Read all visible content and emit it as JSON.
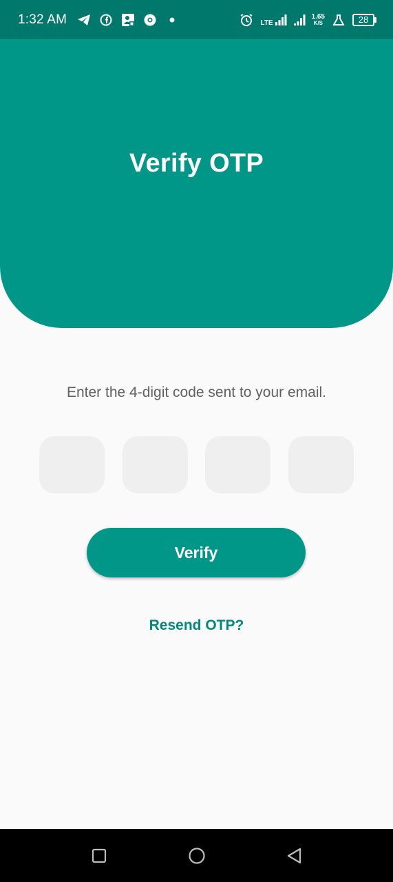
{
  "status_bar": {
    "time": "1:32 AM",
    "network_type": "LTE",
    "speed_value": "1.65",
    "speed_unit": "K/S",
    "battery": "28",
    "icons": [
      "telegram-icon",
      "facebook-icon",
      "app-notification-icon",
      "chrome-icon",
      "dot-icon",
      "alarm-icon",
      "signal-icon",
      "signal-icon-2",
      "lab-icon",
      "battery-icon"
    ]
  },
  "header": {
    "title": "Verify OTP",
    "color": "#009688"
  },
  "form": {
    "instruction": "Enter the 4-digit code sent to your email.",
    "otp_digits": [
      "",
      "",
      "",
      ""
    ],
    "verify_label": "Verify",
    "resend_label": "Resend OTP?"
  },
  "nav_bar": {
    "icons": [
      "recents-square-icon",
      "home-circle-icon",
      "back-triangle-icon"
    ]
  },
  "colors": {
    "status_bar": "#00786b",
    "accent": "#009688",
    "link": "#00897b",
    "otp_box": "#efefef",
    "background": "#fafafa"
  }
}
